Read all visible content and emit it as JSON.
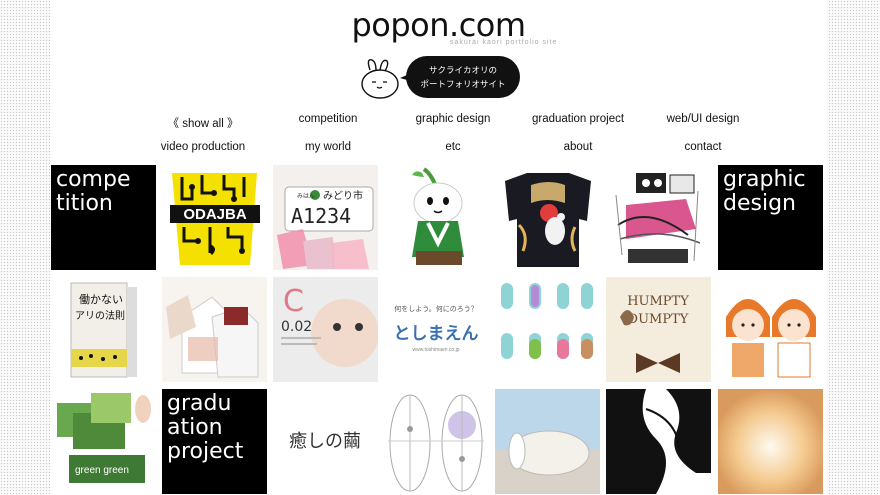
{
  "site": {
    "logo": "popon.com",
    "logo_sub": "sakurai kaori portfolio site",
    "bubble_line1": "サクライカオリの",
    "bubble_line2": "ポートフォリオサイト"
  },
  "nav": {
    "row1": [
      "《 show all 》",
      "competition",
      "graphic design",
      "graduation project",
      "web/UI design"
    ],
    "row2": [
      "video production",
      "my world",
      "etc",
      "about",
      "contact"
    ]
  },
  "tiles": {
    "competition_label": [
      "compe",
      "tition"
    ],
    "graphic_design_label": [
      "graphic",
      "design"
    ],
    "graduation_label": [
      "gradu",
      "ation",
      "project"
    ],
    "odaiba_text": "ODAJBA",
    "plate_city": "みどり市",
    "plate_small": "みはん",
    "plate_number": "A1234",
    "book_title_1": "働かない",
    "book_title_2": "アリの法則",
    "baby_number": "0.02",
    "baby_letter": "C",
    "toshimaen_tagline": "何をしよう。何にのろう？",
    "toshimaen_logo": "としまえん",
    "toshimaen_url": "www.toshimaen.co.jp",
    "humpty_line1": "HUMPTY",
    "humpty_line2": "DUMPTY",
    "green_card": "green green",
    "iyashi_text": "癒しの繭"
  },
  "colors": {
    "accent_black": "#000000",
    "page_bg": "#ffffff",
    "dot_bg": "#fafafa"
  }
}
